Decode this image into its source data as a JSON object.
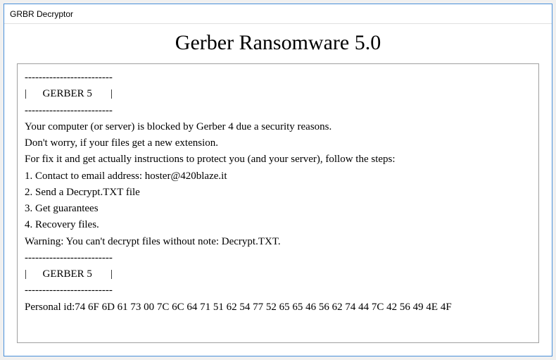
{
  "window": {
    "title": "GRBR Decryptor"
  },
  "heading": "Gerber Ransomware 5.0",
  "panel": {
    "divider": "-------------------------",
    "section_label": "|      GERBER 5       |",
    "lines": {
      "l1": "Your computer (or server) is blocked by Gerber 4 due a security reasons.",
      "l2": "Don't worry, if your files get a new extension.",
      "l3": "For fix it and get actually instructions to protect you (and your server), follow the steps:",
      "l4": "1. Contact to email address: hoster@420blaze.it",
      "l5": "2. Send a Decrypt.TXT file",
      "l6": "3. Get guarantees",
      "l7": "4. Recovery files.",
      "l8": "Warning: You can't decrypt files without note: Decrypt.TXT."
    },
    "personal_id": "Personal id:74 6F 6D 61 73 00 7C 6C 64 71 51 62 54 77 52 65 65 46 56 62 74 44 7C 42 56 49 4E 4F"
  }
}
